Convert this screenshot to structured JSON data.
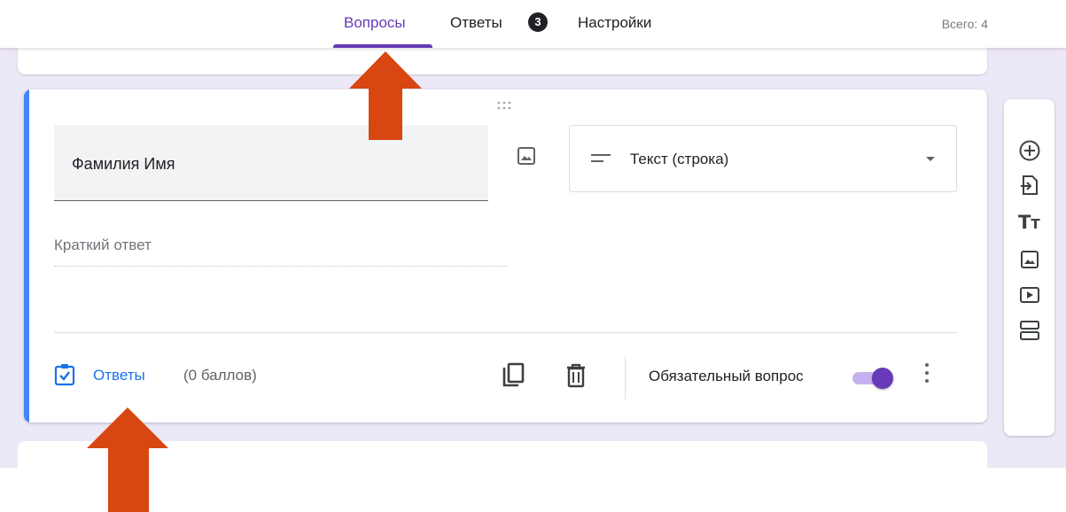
{
  "header": {
    "tabs": [
      {
        "label": "Вопросы",
        "active": true
      },
      {
        "label": "Ответы",
        "badge": "3"
      },
      {
        "label": "Настройки"
      }
    ],
    "total_label": "Всего: 4"
  },
  "question": {
    "title": "Фамилия Имя",
    "type_label": "Текст (строка)",
    "short_answer_placeholder": "Краткий ответ",
    "answers_link": "Ответы",
    "points": "(0 баллов)",
    "required_label": "Обязательный вопрос",
    "required": true
  },
  "toolbar": {
    "items": [
      "add-question-icon",
      "import-questions-icon",
      "add-title-icon",
      "add-image-icon",
      "add-video-icon",
      "add-section-icon"
    ]
  },
  "colors": {
    "accent": "#673ab7",
    "link": "#1a73e8",
    "card_accent": "#4285f4",
    "canvas": "#ede8f7",
    "arrow": "#d84612"
  }
}
